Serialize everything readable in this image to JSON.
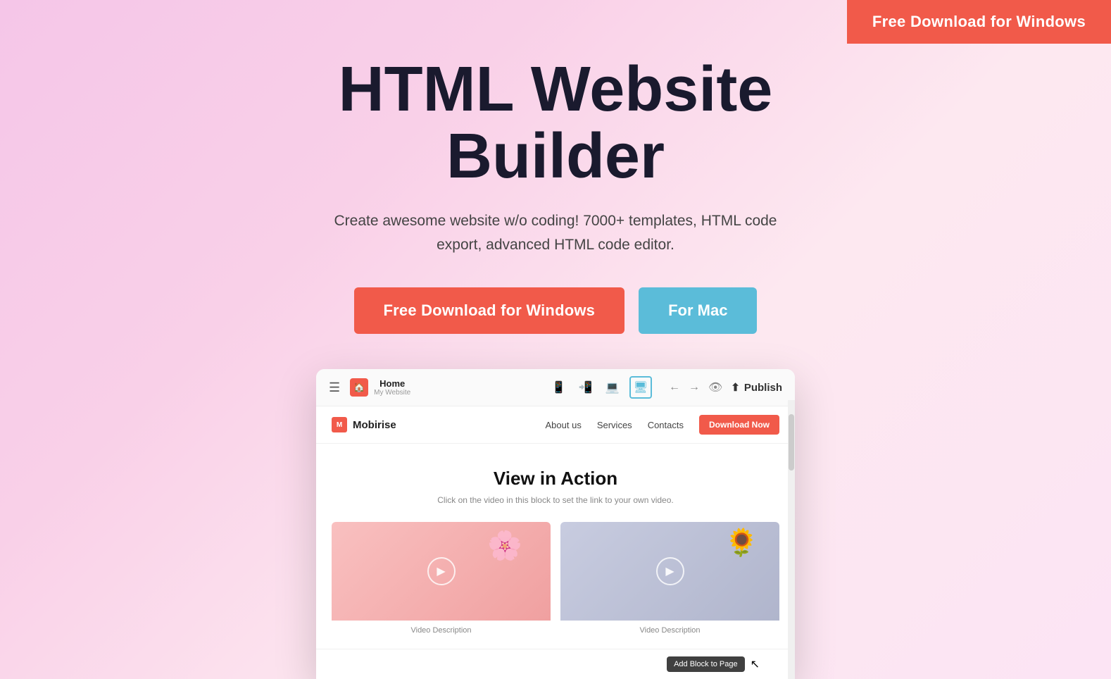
{
  "top_bar": {
    "download_btn": "Free Download for Windows"
  },
  "hero": {
    "title": "HTML Website Builder",
    "subtitle": "Create awesome website w/o coding! 7000+ templates, HTML code export, advanced HTML code editor.",
    "btn_windows": "Free Download for Windows",
    "btn_mac": "For Mac"
  },
  "app_preview": {
    "toolbar": {
      "menu_icon": "≡",
      "home_title": "Home",
      "home_subtitle": "My Website",
      "device_icons": [
        "mobile",
        "tablet",
        "laptop",
        "desktop"
      ],
      "back_icon": "←",
      "forward_icon": "→",
      "preview_icon": "👁",
      "upload_icon": "⬆",
      "publish_label": "Publish"
    },
    "inner_nav": {
      "logo_text": "Mobirise",
      "links": [
        "About us",
        "Services",
        "Contacts"
      ],
      "download_btn": "Download Now"
    },
    "inner_content": {
      "title": "View in Action",
      "subtitle": "Click on the video in this block to set the link to your own video.",
      "videos": [
        {
          "description": "Video Description",
          "thumb_type": "pink"
        },
        {
          "description": "Video Description",
          "thumb_type": "grey"
        }
      ]
    },
    "add_block_tooltip": "Add Block to Page",
    "cursor": "↖"
  }
}
